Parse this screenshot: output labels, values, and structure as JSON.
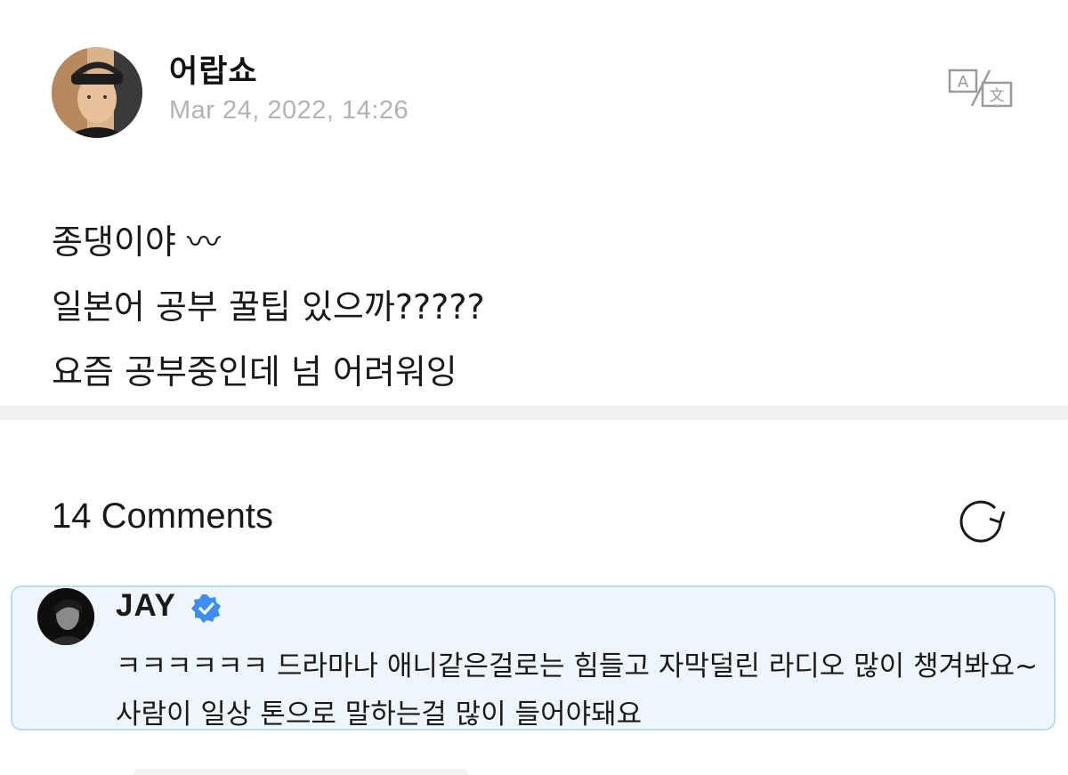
{
  "post": {
    "author": "어랍쇼",
    "timestamp": "Mar 24, 2022, 14:26",
    "body_lines": [
      "종댕이야 〰",
      "일본어 공부 꿀팁 있으까?????",
      "요즘 공부중인데 넘 어려워잉"
    ],
    "translate_icon": "translate-icon"
  },
  "comments": {
    "header": "14 Comments",
    "refresh_icon": "refresh-icon",
    "items": [
      {
        "author": "JAY",
        "verified": true,
        "verified_color": "#3d8ef0",
        "text": "ㅋㅋㅋㅋㅋㅋ 드라마나 애니같은걸로는 힘들고 자막덜린 라디오 많이 챙겨봐요~ 사람이 일상 톤으로 말하는걸 많이 들어야돼요",
        "highlight_bg": "#eef6fb",
        "highlight_border": "#b9dcee"
      }
    ]
  }
}
